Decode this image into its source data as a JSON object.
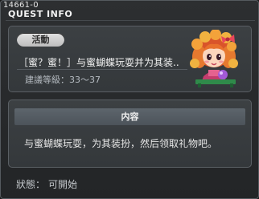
{
  "window": {
    "quest_id": "14661-0",
    "title": "QUEST INFO"
  },
  "quest": {
    "category_badge": "活動",
    "name": "［蜜？蜜！］与蜜蝴蝶玩耍并为其装..",
    "level_label": "建議等級：",
    "level_range": "33～37",
    "npc_portrait": "npc-girl-portrait"
  },
  "content": {
    "header": "内容",
    "description": "与蜜蝴蝶玩耍，为其装扮，然后领取礼物吧。"
  },
  "status": {
    "label": "狀態：",
    "value": "可開始"
  },
  "colors": {
    "background": "#2d2f31",
    "panel": "#3c4043",
    "section_bar": "#5d656c",
    "badge": "#d6d6d6"
  }
}
